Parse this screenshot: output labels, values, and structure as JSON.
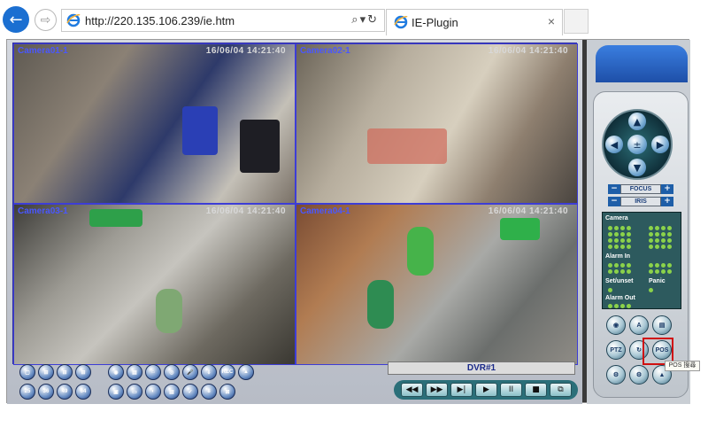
{
  "browser": {
    "url": "http://220.135.106.239/ie.htm",
    "tab_title": "IE-Plugin",
    "tab_close": "×",
    "back": "←",
    "forward": "⇨",
    "tools": "⌕▾↻"
  },
  "cameras": [
    {
      "label": "Camera01-1",
      "timestamp": "16/06/04 14:21:40"
    },
    {
      "label": "Camera02-1",
      "timestamp": "16/06/04 14:21:40"
    },
    {
      "label": "Camera03-1",
      "timestamp": "16/06/04 14:21:40"
    },
    {
      "label": "Camera04-1",
      "timestamp": "16/06/04 14:21:40"
    }
  ],
  "toolbar": {
    "row1": [
      "▢",
      "⊞",
      "⊞",
      "⊞",
      "◉",
      "▤",
      "⌂",
      "◎",
      "🎤",
      "⇩",
      "REC",
      "▲"
    ],
    "row2": [
      "25",
      "36",
      "49",
      "64",
      "▣",
      "▭",
      "◐",
      "▤",
      "✓",
      "8",
      "⊠"
    ]
  },
  "dvr": {
    "label": "DVR#1"
  },
  "playback": {
    "rewind": "◀◀",
    "fast_forward": "▶▶",
    "next_frame": "▶|",
    "play": "▶",
    "pause": "II",
    "stop": "■",
    "copy": "⧉"
  },
  "ptz": {
    "center": "±",
    "up": "▲",
    "down": "▼",
    "left": "◀",
    "right": "▶",
    "minus": "−",
    "plus": "+",
    "focus": "FOCUS",
    "iris": "IRIS"
  },
  "status": {
    "camera": "Camera",
    "alarm_in": "Alarm In",
    "set_unset": "Set/unset",
    "panic": "Panic",
    "alarm_out": "Alarm Out",
    "led_color": "#8bd24a"
  },
  "function_buttons": [
    {
      "label": "◉"
    },
    {
      "label": "A"
    },
    {
      "label": "▤"
    },
    {
      "label": "PTZ"
    },
    {
      "label": "↻"
    },
    {
      "label": "POS"
    },
    {
      "label": "⚙"
    },
    {
      "label": "⚙"
    },
    {
      "label": "▲"
    }
  ],
  "tooltip": "POS 搜尋",
  "highlight_color": "#d01010"
}
